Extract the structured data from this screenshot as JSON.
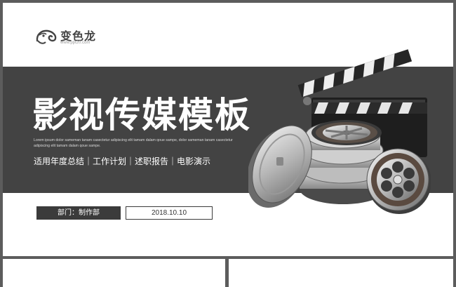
{
  "logo": {
    "name": "变色龙",
    "url": "www.ppt20.com",
    "icon": "chameleon-icon"
  },
  "title": "影视传媒模板",
  "description": "Lorem ipsum dolor sameman tanam casectetur adipiscing elit tamam dalam qoue sampe, dolor sameman tanam casectetur adipiscing elit tamam dalam qoue sampe.",
  "tags": "适用年度总结｜工作计划｜述职报告｜电影演示",
  "department": "部门：制作部",
  "date": "2018.10.10",
  "illustration": "film-clapperboard-and-reels",
  "colors": {
    "band": "#434343",
    "frame": "#5c5c5c",
    "background": "#ffffff",
    "text_light": "#ffffff"
  }
}
